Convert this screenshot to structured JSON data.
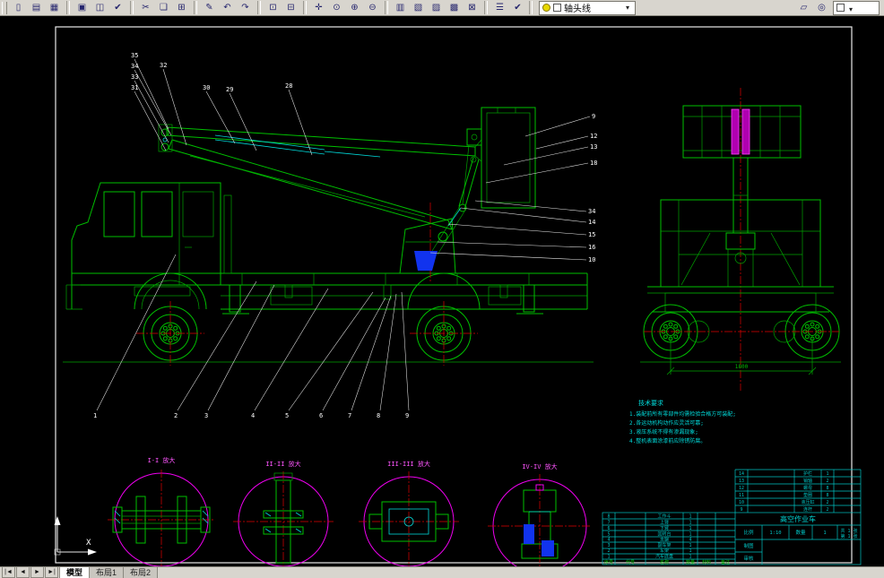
{
  "toolbar": {
    "groups": [
      {
        "name": "file",
        "icons": [
          {
            "name": "new",
            "glyph": "▯"
          },
          {
            "name": "open",
            "glyph": "▤"
          },
          {
            "name": "save",
            "glyph": "▦"
          }
        ]
      },
      {
        "name": "print",
        "icons": [
          {
            "name": "plot",
            "glyph": "▣"
          },
          {
            "name": "plot-preview",
            "glyph": "◫"
          },
          {
            "name": "spell",
            "glyph": "✔"
          }
        ]
      },
      {
        "name": "clipboard",
        "icons": [
          {
            "name": "cut",
            "glyph": "✂"
          },
          {
            "name": "copy",
            "glyph": "❏"
          },
          {
            "name": "paste",
            "glyph": "⊞"
          }
        ]
      },
      {
        "name": "edit",
        "icons": [
          {
            "name": "match-properties",
            "glyph": "✎"
          },
          {
            "name": "undo",
            "glyph": "↶"
          },
          {
            "name": "redo",
            "glyph": "↷"
          }
        ]
      },
      {
        "name": "insert",
        "icons": [
          {
            "name": "insert-block",
            "glyph": "⊡"
          },
          {
            "name": "osnap-settings",
            "glyph": "⊟"
          }
        ]
      },
      {
        "name": "view",
        "icons": [
          {
            "name": "pan",
            "glyph": "✛"
          },
          {
            "name": "zoom-realtime",
            "glyph": "⊙"
          },
          {
            "name": "zoom-window",
            "glyph": "⊕"
          },
          {
            "name": "zoom-previous",
            "glyph": "⊖"
          }
        ]
      },
      {
        "name": "palettes",
        "icons": [
          {
            "name": "properties",
            "glyph": "▥"
          },
          {
            "name": "design-center",
            "glyph": "▧"
          },
          {
            "name": "tool-palettes",
            "glyph": "▨"
          },
          {
            "name": "sheet-set",
            "glyph": "▩"
          },
          {
            "name": "quick-calc",
            "glyph": "⊠"
          }
        ]
      },
      {
        "name": "layers",
        "icons": [
          {
            "name": "layer-properties",
            "glyph": "☰"
          },
          {
            "name": "make-layer-current",
            "glyph": "✔"
          }
        ]
      }
    ],
    "right_icons": [
      {
        "name": "named-views",
        "glyph": "▱"
      },
      {
        "name": "3d-orbit",
        "glyph": "◎"
      }
    ],
    "layer_combo": {
      "value": "轴头线"
    }
  },
  "tabs": {
    "nav": [
      "|◄",
      "◄",
      "►",
      "►|"
    ],
    "items": [
      {
        "label": "模型"
      },
      {
        "label": "布局1"
      },
      {
        "label": "布局2"
      }
    ]
  },
  "drawing": {
    "callouts_left": [
      "35",
      "34",
      "33",
      "32",
      "31"
    ],
    "callouts_top": [
      "30",
      "29",
      "28"
    ],
    "callouts_right": [
      "9",
      "12",
      "13",
      "18",
      "34",
      "14",
      "15",
      "16",
      "10"
    ],
    "callouts_bottom": [
      "1",
      "2",
      "3",
      "4",
      "5",
      "6",
      "7",
      "8",
      "9"
    ],
    "detail_labels": [
      "I-I 放大",
      "II-II 放大",
      "III-III 放大",
      "IV-IV 放大"
    ],
    "dimension": "1800",
    "ucs_x_label": "X",
    "notes": {
      "title": "技术要求",
      "lines": [
        "1.装配前所有零部件均需检验合格方可装配;",
        "2.各运动机构动作应灵活可靠;",
        "3.液压系统不得有渗漏现象;",
        "4.整机表面涂漆前应除锈防腐。"
      ]
    },
    "title_block": {
      "title": "高空作业车",
      "scale_label": "比例",
      "scale": "1:10",
      "qty_label": "数量",
      "qty": "1",
      "sheet1": "共 1 张",
      "sheet2": "第 1 张",
      "drawn_label": "制图",
      "checked_label": "审核",
      "bom_headers": [
        "序号",
        "代号",
        "名称",
        "数量",
        "材料",
        "备注"
      ],
      "bom_rows_upper": [
        [
          "14",
          "",
          "护栏",
          "1"
        ],
        [
          "13",
          "",
          "销轴",
          "2"
        ],
        [
          "12",
          "",
          "螺母",
          "8"
        ],
        [
          "11",
          "",
          "垫圈",
          "8"
        ],
        [
          "10",
          "",
          "液压缸",
          "2"
        ],
        [
          "9",
          "",
          "连杆",
          "2"
        ]
      ],
      "bom_rows_lower": [
        [
          "8",
          "",
          "工作斗",
          "1"
        ],
        [
          "7",
          "",
          "上臂",
          "1"
        ],
        [
          "6",
          "",
          "下臂",
          "1"
        ],
        [
          "5",
          "",
          "回转台",
          "1"
        ],
        [
          "4",
          "",
          "支腿",
          "4"
        ],
        [
          "3",
          "",
          "副车架",
          "1"
        ],
        [
          "2",
          "",
          "车架",
          "1"
        ],
        [
          "1",
          "",
          "汽车底盘",
          "1"
        ]
      ]
    }
  }
}
